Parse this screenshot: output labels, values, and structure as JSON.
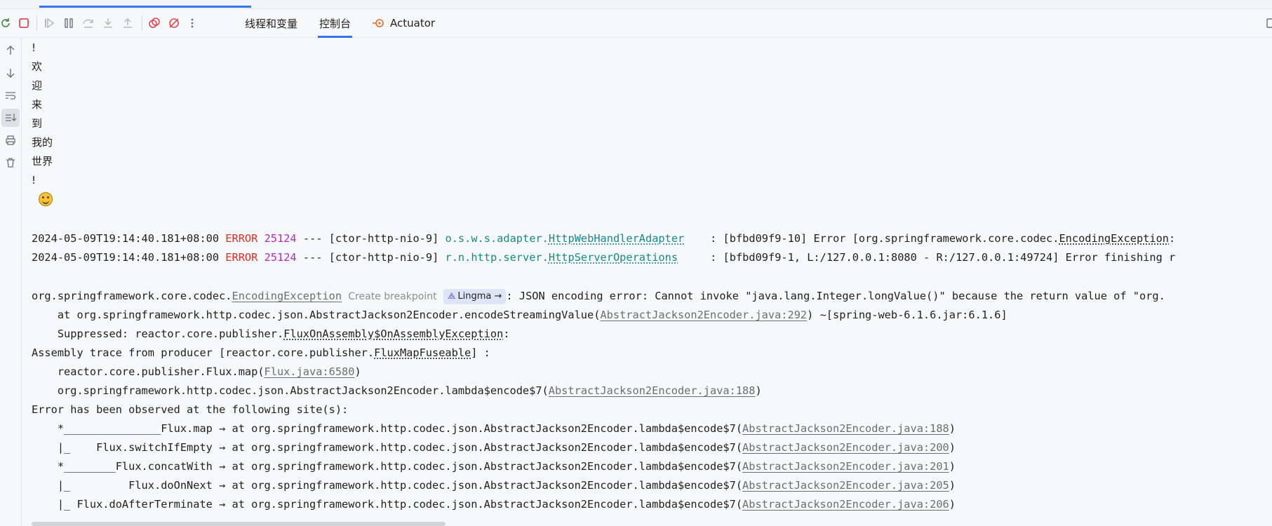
{
  "toolbar": {
    "tabs": [
      "线程和变量",
      "控制台",
      "Actuator"
    ],
    "active_tab": "控制台"
  },
  "console": {
    "text_lines": [
      "!",
      "欢",
      "迎",
      "来",
      "到",
      "我的",
      "世界",
      "!"
    ],
    "log1": {
      "timestamp": "2024-05-09T19:14:40.181+08:00",
      "level": "ERROR",
      "pid": "25124",
      "sep": "---",
      "thread": "[ctor-http-nio-9]",
      "logger_pkg": "o.s.w.s.adapter.",
      "logger_cls": "HttpWebHandlerAdapter",
      "message": ": [bfbd09f9-10] Error [org.springframework.core.codec.",
      "message_cls": "EncodingException",
      "message_end": ":"
    },
    "log2": {
      "timestamp": "2024-05-09T19:14:40.181+08:00",
      "level": "ERROR",
      "pid": "25124",
      "sep": "---",
      "thread": "[ctor-http-nio-9]",
      "logger_pkg": "r.n.http.server.",
      "logger_cls": "HttpServerOperations",
      "message": ": [bfbd09f9-1, L:/127.0.0.1:8080 - R:/127.0.0.1:49724] Error finishing r"
    },
    "exception": {
      "pkg": "org.springframework.core.codec.",
      "cls": "EncodingException",
      "hint": "Create breakpoint",
      "badge": "Lingma →",
      "message": ": JSON encoding error: Cannot invoke \"java.lang.Integer.longValue()\" because the return value of \"org."
    },
    "trace1": {
      "prefix": "    at org.springframework.http.codec.json.AbstractJackson2Encoder.encodeStreamingValue(",
      "link": "AbstractJackson2Encoder.java:292",
      "suffix": ") ~[spring-web-6.1.6.jar:6.1.6]"
    },
    "suppressed": {
      "prefix": "    Suppressed: reactor.core.publisher.",
      "cls": "FluxOnAssembly$OnAssemblyException",
      "suffix": ":"
    },
    "assembly": {
      "prefix": "Assembly trace from producer [reactor.core.publisher.",
      "cls": "FluxMapFuseable",
      "suffix": "] :"
    },
    "asm1": {
      "prefix": "    reactor.core.publisher.Flux.map(",
      "link": "Flux.java:6580",
      "suffix": ")"
    },
    "asm2": {
      "prefix": "    org.springframework.http.codec.json.AbstractJackson2Encoder.lambda$encode$7(",
      "link": "AbstractJackson2Encoder.java:188",
      "suffix": ")"
    },
    "observed": "Error has been observed at the following site(s):",
    "sites": [
      {
        "prefix": "    *_______________Flux.map → at org.springframework.http.codec.json.AbstractJackson2Encoder.lambda$encode$7(",
        "link": "AbstractJackson2Encoder.java:188",
        "suffix": ")"
      },
      {
        "prefix": "    |_    Flux.switchIfEmpty → at org.springframework.http.codec.json.AbstractJackson2Encoder.lambda$encode$7(",
        "link": "AbstractJackson2Encoder.java:200",
        "suffix": ")"
      },
      {
        "prefix": "    *________Flux.concatWith → at org.springframework.http.codec.json.AbstractJackson2Encoder.lambda$encode$7(",
        "link": "AbstractJackson2Encoder.java:201",
        "suffix": ")"
      },
      {
        "prefix": "    |_         Flux.doOnNext → at org.springframework.http.codec.json.AbstractJackson2Encoder.lambda$encode$7(",
        "link": "AbstractJackson2Encoder.java:205",
        "suffix": ")"
      },
      {
        "prefix": "    |_ Flux.doAfterTerminate → at org.springframework.http.codec.json.AbstractJackson2Encoder.lambda$encode$7(",
        "link": "AbstractJackson2Encoder.java:206",
        "suffix": ")"
      }
    ]
  },
  "colors": {
    "accent": "#3574f0",
    "error": "#e02d24",
    "pid": "#b629c2",
    "logger": "#148a8a",
    "stop": "#e5484d"
  }
}
